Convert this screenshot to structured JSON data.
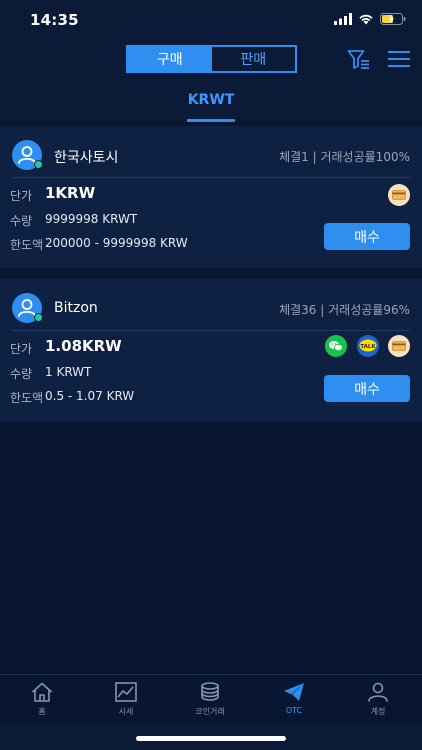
{
  "status_bar": {
    "time": "14:35"
  },
  "header": {
    "segments": [
      "구매",
      "판매"
    ],
    "active_segment": "구매",
    "filter_icon": "filter-icon",
    "menu_icon": "hamburger-menu-icon"
  },
  "tabs": {
    "active": "KRWT"
  },
  "labels": {
    "price": "단가",
    "quantity": "수량",
    "limit": "한도액",
    "buy_button": "매수"
  },
  "orders": [
    {
      "merchant": "한국사토시",
      "stats": "체결1 | 거래성공률100%",
      "price": "1KRW",
      "quantity": "9999998 KRWT",
      "limit": "200000 - 9999998 KRW",
      "payment_methods": [
        "bank-card-icon"
      ]
    },
    {
      "merchant": "Bitzon",
      "stats": "체결36 | 거래성공률96%",
      "price": "1.08KRW",
      "quantity": "1 KRWT",
      "limit": "0.5 - 1.07 KRW",
      "payment_methods": [
        "wechat-icon",
        "kakaotalk-icon",
        "bank-card-icon"
      ],
      "kakao_label": "TALK"
    }
  ],
  "bottom_nav": [
    {
      "label": "홈",
      "icon": "home-icon"
    },
    {
      "label": "시세",
      "icon": "chart-icon"
    },
    {
      "label": "코인거래",
      "icon": "coins-icon"
    },
    {
      "label": "OTC",
      "icon": "paper-plane-icon",
      "active": true
    },
    {
      "label": "계정",
      "icon": "user-icon"
    }
  ],
  "colors": {
    "background": "#0b1a36",
    "card": "#0f2143",
    "accent": "#2f8ff0",
    "online": "#27c99a"
  }
}
